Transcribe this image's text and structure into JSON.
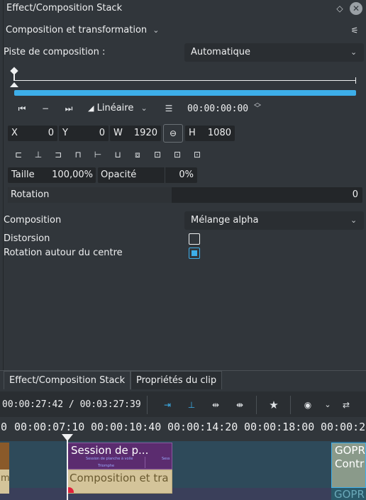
{
  "panel": {
    "title": "Effect/Composition Stack",
    "effect_name": "Composition et transformation",
    "composition_track_label": "Piste de composition :",
    "composition_track_value": "Automatique"
  },
  "keyframes": {
    "interpolation": "Linéaire",
    "timecode": "00:00:00:00"
  },
  "geometry": {
    "x_label": "X",
    "x_value": "0",
    "y_label": "Y",
    "y_value": "0",
    "w_label": "W",
    "w_value": "1920",
    "h_label": "H",
    "h_value": "1080",
    "size_label": "Taille",
    "size_value": "100,00%",
    "opacity_label": "Opacité",
    "opacity_value": "0%"
  },
  "rotation": {
    "label": "Rotation",
    "value": "0"
  },
  "composition": {
    "label": "Composition",
    "value": "Mélange alpha"
  },
  "options": [
    {
      "label": "Distorsion",
      "checked": false
    },
    {
      "label": "Rotation autour du centre",
      "checked": true
    }
  ],
  "tabs": [
    "Effect/Composition Stack",
    "Propriétés du clip"
  ],
  "timeline": {
    "position": "00:00:27:42 / 00:03:27:39",
    "ruler": [
      "0",
      "00:00:07:10",
      "00:00:10:40",
      "00:00:14:20",
      "00:00:18:00",
      "00:00:2"
    ],
    "clip_video_title": "Session de p...",
    "clip_video_sub1": "Session de planche à voile",
    "clip_video_sub2": "Triomphe",
    "clip_video_sub3": "Sess",
    "clip_composition": "Composition et tra",
    "clip_left_label": "m",
    "clip_right_line1": "GOPR",
    "clip_right_line2": "Contr",
    "clip_right_line3": "GOPR"
  },
  "colors": {
    "accent": "#3daee9",
    "clip_purple": "#5b2c6f",
    "composition_yellow": "#d4c49a"
  }
}
